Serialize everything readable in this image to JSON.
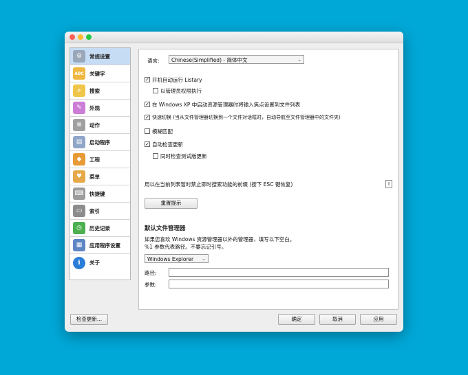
{
  "sidebar": {
    "items": [
      {
        "label": "常规设置",
        "icon": "gear-icon",
        "color": "#9aa7b8",
        "glyph": "⚙",
        "active": true
      },
      {
        "label": "关键字",
        "icon": "abc-icon",
        "color": "#f0b840",
        "glyph": "ABC",
        "active": false
      },
      {
        "label": "搜索",
        "icon": "magnifier-icon",
        "color": "#f0c64a",
        "glyph": "⌕",
        "active": false
      },
      {
        "label": "外观",
        "icon": "palette-icon",
        "color": "#cc7ed6",
        "glyph": "✎",
        "active": false
      },
      {
        "label": "动作",
        "icon": "list-icon",
        "color": "#a0a0a0",
        "glyph": "≡",
        "active": false
      },
      {
        "label": "启动程序",
        "icon": "window-icon",
        "color": "#8fa6c8",
        "glyph": "▤",
        "active": false
      },
      {
        "label": "工程",
        "icon": "cubes-icon",
        "color": "#e79a35",
        "glyph": "◆",
        "active": false
      },
      {
        "label": "菜单",
        "icon": "folder-heart-icon",
        "color": "#e6a94a",
        "glyph": "♥",
        "active": false
      },
      {
        "label": "快捷键",
        "icon": "keyboard-icon",
        "color": "#9d9d9d",
        "glyph": "⌨",
        "active": false
      },
      {
        "label": "索引",
        "icon": "drive-icon",
        "color": "#8c8c8c",
        "glyph": "▭",
        "active": false
      },
      {
        "label": "历史记录",
        "icon": "clock-icon",
        "color": "#4caf50",
        "glyph": "◷",
        "active": false
      },
      {
        "label": "应用程序设置",
        "icon": "app-grid-icon",
        "color": "#5e86c4",
        "glyph": "▦",
        "active": false
      },
      {
        "label": "关于",
        "icon": "info-icon",
        "color": "#2a7ed8",
        "glyph": "i",
        "active": false
      }
    ]
  },
  "general": {
    "language_label": "语言:",
    "language_value": "Chinese(Simplified) - 简体中文",
    "checkboxes": [
      {
        "label": "开机自动运行 Listary",
        "checked": true
      },
      {
        "label": "以管理员权限执行",
        "checked": false
      },
      {
        "label": "在 Windows XP 中启动资源管理器时将输入焦点设置到文件列表",
        "checked": true
      },
      {
        "label": "快速切换 (当从文件管理器切换到一个文件对话框时，自动导航至文件管理器中的文件夹)",
        "checked": true
      },
      {
        "label": "模糊匹配",
        "checked": false
      },
      {
        "label": "自动检查更新",
        "checked": true
      },
      {
        "label": "同时检查测试版更新",
        "checked": false
      }
    ],
    "hotkey_note": "用以在当前列表暂时禁止即时搜索功能的前缀 (按下 ESC 键恢复)",
    "hotkey_value": "I",
    "reset_button": "重置提示",
    "file_manager_title": "默认文件管理器",
    "file_manager_desc_1": "如果您喜欢 Windows 资源管理器以外的管理器，填写以下空白。",
    "file_manager_desc_2": "%1 参数代表路径。不要忘记引号。",
    "file_manager_value": "Windows Explorer",
    "path_label": "路径:",
    "params_label": "参数:",
    "path_value": "",
    "params_value": ""
  },
  "footer": {
    "check_updates": "检查更新...",
    "ok": "确定",
    "cancel": "取消",
    "apply": "应用"
  }
}
